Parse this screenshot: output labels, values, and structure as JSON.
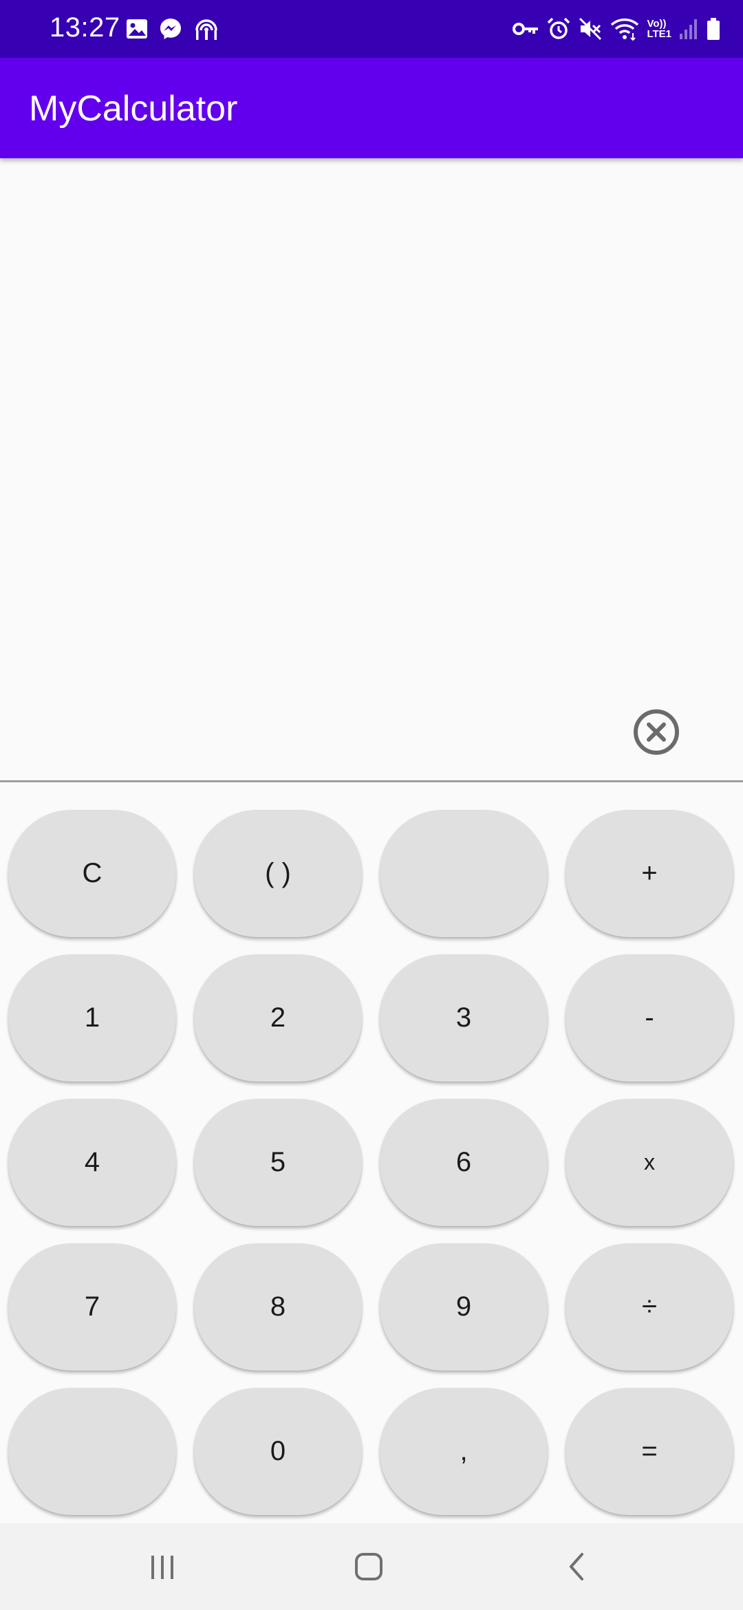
{
  "status_bar": {
    "time": "13:27",
    "left_icons": [
      "image-icon",
      "messenger-icon",
      "hotspot-icon"
    ],
    "right_icons": [
      "vpn-key-icon",
      "alarm-icon",
      "mute-icon",
      "wifi-icon",
      "volte-lte-icon",
      "signal-icon",
      "battery-icon"
    ],
    "lte_line1": "Vo))",
    "lte_line2": "LTE1"
  },
  "app_bar": {
    "title": "MyCalculator",
    "color": "#6200ee",
    "status_color": "#3700b3"
  },
  "display": {
    "value": "",
    "clear_icon": "clear-circle-icon"
  },
  "keypad": {
    "rows": [
      [
        {
          "label": "C"
        },
        {
          "label": "( )"
        },
        {
          "label": ""
        },
        {
          "label": "+"
        }
      ],
      [
        {
          "label": "1"
        },
        {
          "label": "2"
        },
        {
          "label": "3"
        },
        {
          "label": "-"
        }
      ],
      [
        {
          "label": "4"
        },
        {
          "label": "5"
        },
        {
          "label": "6"
        },
        {
          "label": "x"
        }
      ],
      [
        {
          "label": "7"
        },
        {
          "label": "8"
        },
        {
          "label": "9"
        },
        {
          "label": "÷"
        }
      ],
      [
        {
          "label": ""
        },
        {
          "label": "0"
        },
        {
          "label": ","
        },
        {
          "label": "="
        }
      ]
    ],
    "key_color": "#e0e0e0"
  },
  "nav_bar": {
    "buttons": [
      "recents-icon",
      "home-icon",
      "back-icon"
    ]
  }
}
